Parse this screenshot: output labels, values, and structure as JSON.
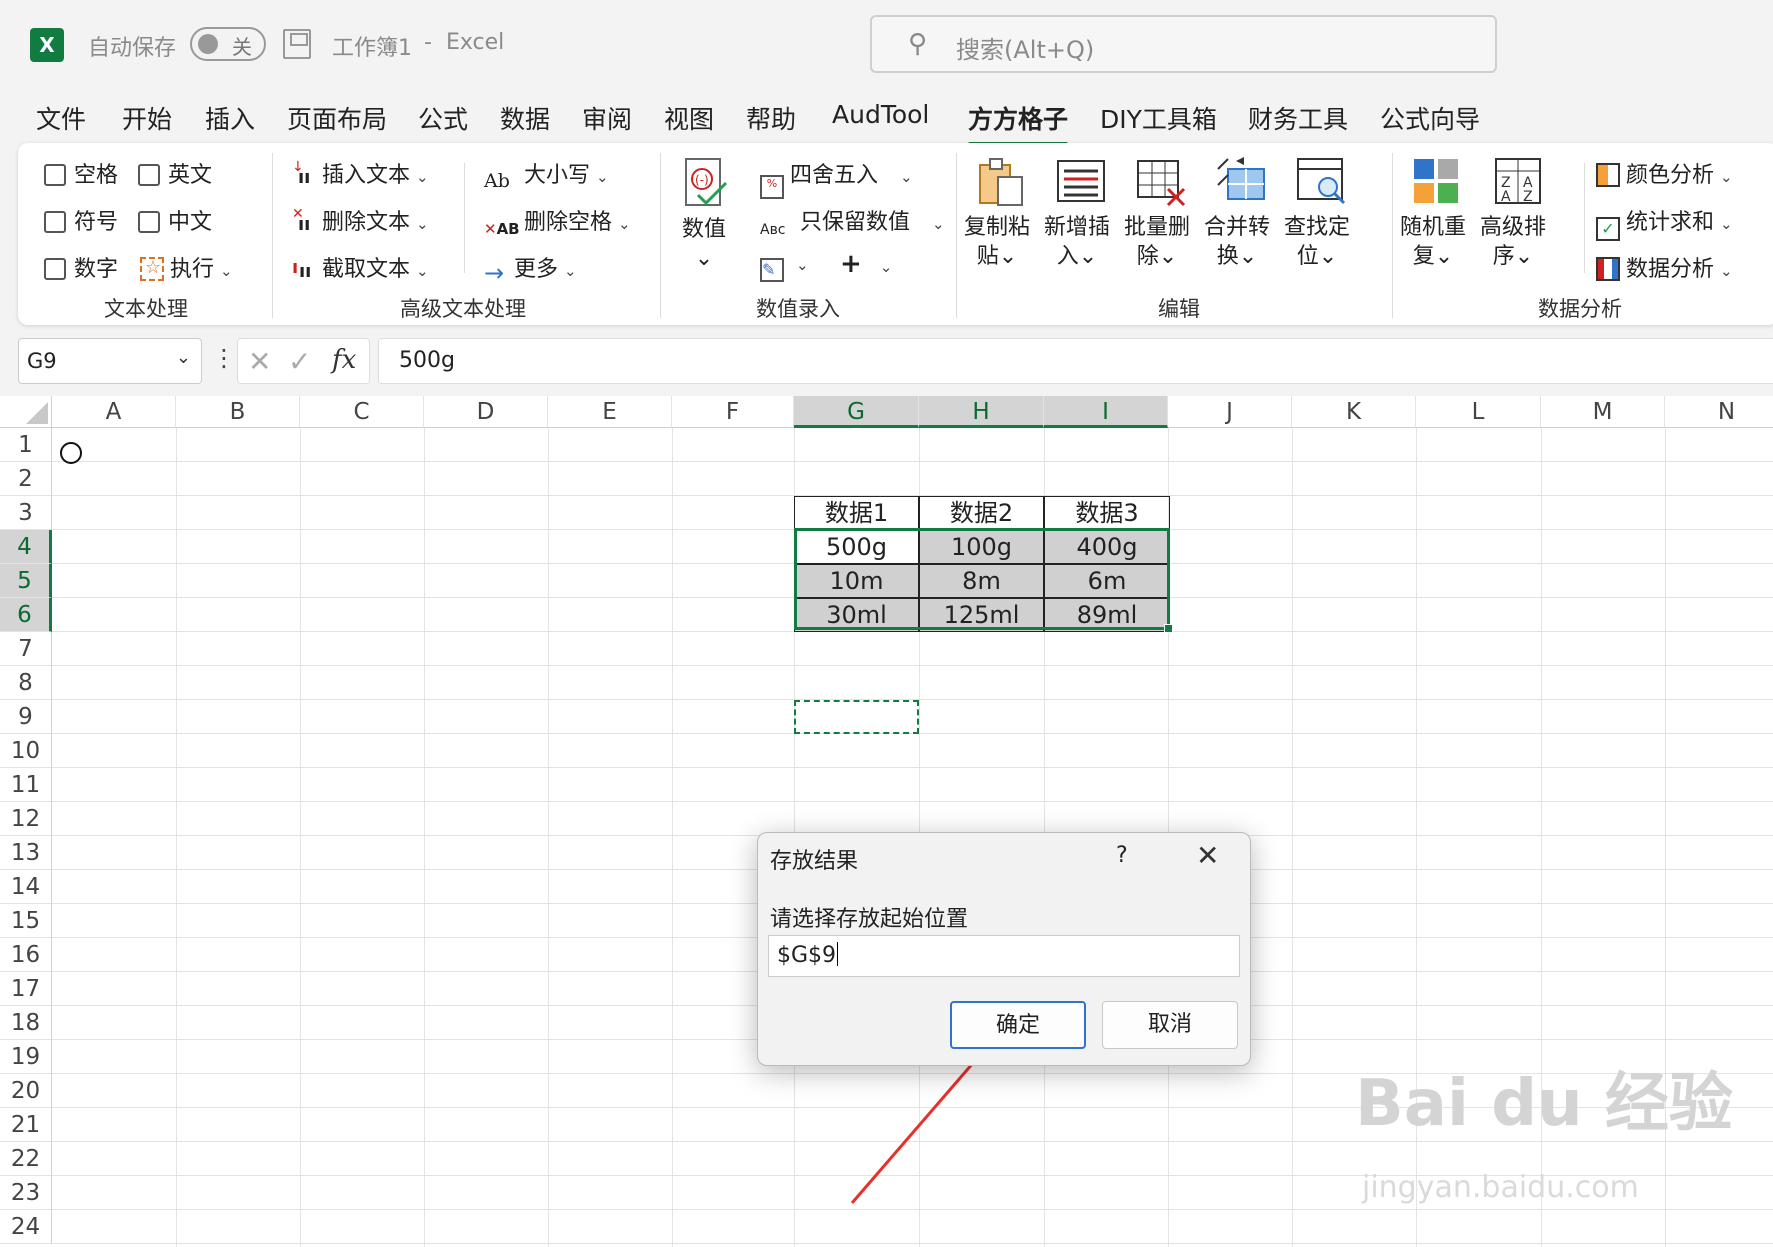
{
  "titlebar": {
    "autosave_label": "自动保存",
    "autosave_state": "关",
    "workbook": "工作簿1",
    "separator": "-",
    "app": "Excel",
    "search_placeholder": "搜索(Alt+Q)"
  },
  "tabs": [
    "文件",
    "开始",
    "插入",
    "页面布局",
    "公式",
    "数据",
    "审阅",
    "视图",
    "帮助",
    "AudTool",
    "方方格子",
    "DIY工具箱",
    "财务工具",
    "公式向导"
  ],
  "active_tab": "方方格子",
  "ribbon": {
    "text_group": {
      "checkboxes": [
        "空格",
        "英文",
        "符号",
        "中文",
        "数字"
      ],
      "exec_label": "执行",
      "group_label": "文本处理"
    },
    "adv_text_group": {
      "insert": "插入文本",
      "delete": "删除文本",
      "extract": "截取文本",
      "case": "大小写",
      "del_space": "删除空格",
      "more": "更多",
      "group_label": "高级文本处理"
    },
    "value_group": {
      "value_btn": "数值",
      "round": "四舍五入",
      "keep_num": "只保留数值",
      "group_label": "数值录入"
    },
    "edit_group": {
      "buttons": [
        [
          "复制粘",
          "贴"
        ],
        [
          "新增插",
          "入"
        ],
        [
          "批量删",
          "除"
        ],
        [
          "合并转",
          "换"
        ],
        [
          "查找定",
          "位"
        ]
      ],
      "group_label": "编辑"
    },
    "analysis_group": {
      "buttons": [
        [
          "随机重",
          "复"
        ],
        [
          "高级排",
          "序"
        ]
      ],
      "color": "颜色分析",
      "stat": "统计求和",
      "data": "数据分析",
      "group_label": "数据分析"
    }
  },
  "formula_bar": {
    "namebox": "G9",
    "fx": "fx",
    "value": "500g"
  },
  "sheet": {
    "columns": [
      "A",
      "B",
      "C",
      "D",
      "E",
      "F",
      "G",
      "H",
      "I",
      "J",
      "K",
      "L",
      "M",
      "N"
    ],
    "rows": [
      "1",
      "2",
      "3",
      "4",
      "5",
      "6",
      "7",
      "8",
      "9",
      "10",
      "11",
      "12",
      "13",
      "14",
      "15",
      "16",
      "17",
      "18",
      "19",
      "20",
      "21",
      "22",
      "23",
      "24"
    ],
    "table_header": [
      "数据1",
      "数据2",
      "数据3"
    ],
    "table_rows": [
      [
        "500g",
        "100g",
        "400g"
      ],
      [
        "10m",
        "8m",
        "6m"
      ],
      [
        "30ml",
        "125ml",
        "89ml"
      ]
    ]
  },
  "dialog": {
    "title": "存放结果",
    "help": "?",
    "prompt": "请选择存放起始位置",
    "value": "$G$9",
    "ok": "确定",
    "cancel": "取消"
  },
  "watermark": {
    "brand": "Bai du 经验",
    "url": "jingyan.baidu.com"
  },
  "colors": {
    "excel_green": "#107c41",
    "selection_gray": "#d0d0d0",
    "annotation_red": "#e8302a",
    "primary_button_border": "#2f74c8"
  }
}
